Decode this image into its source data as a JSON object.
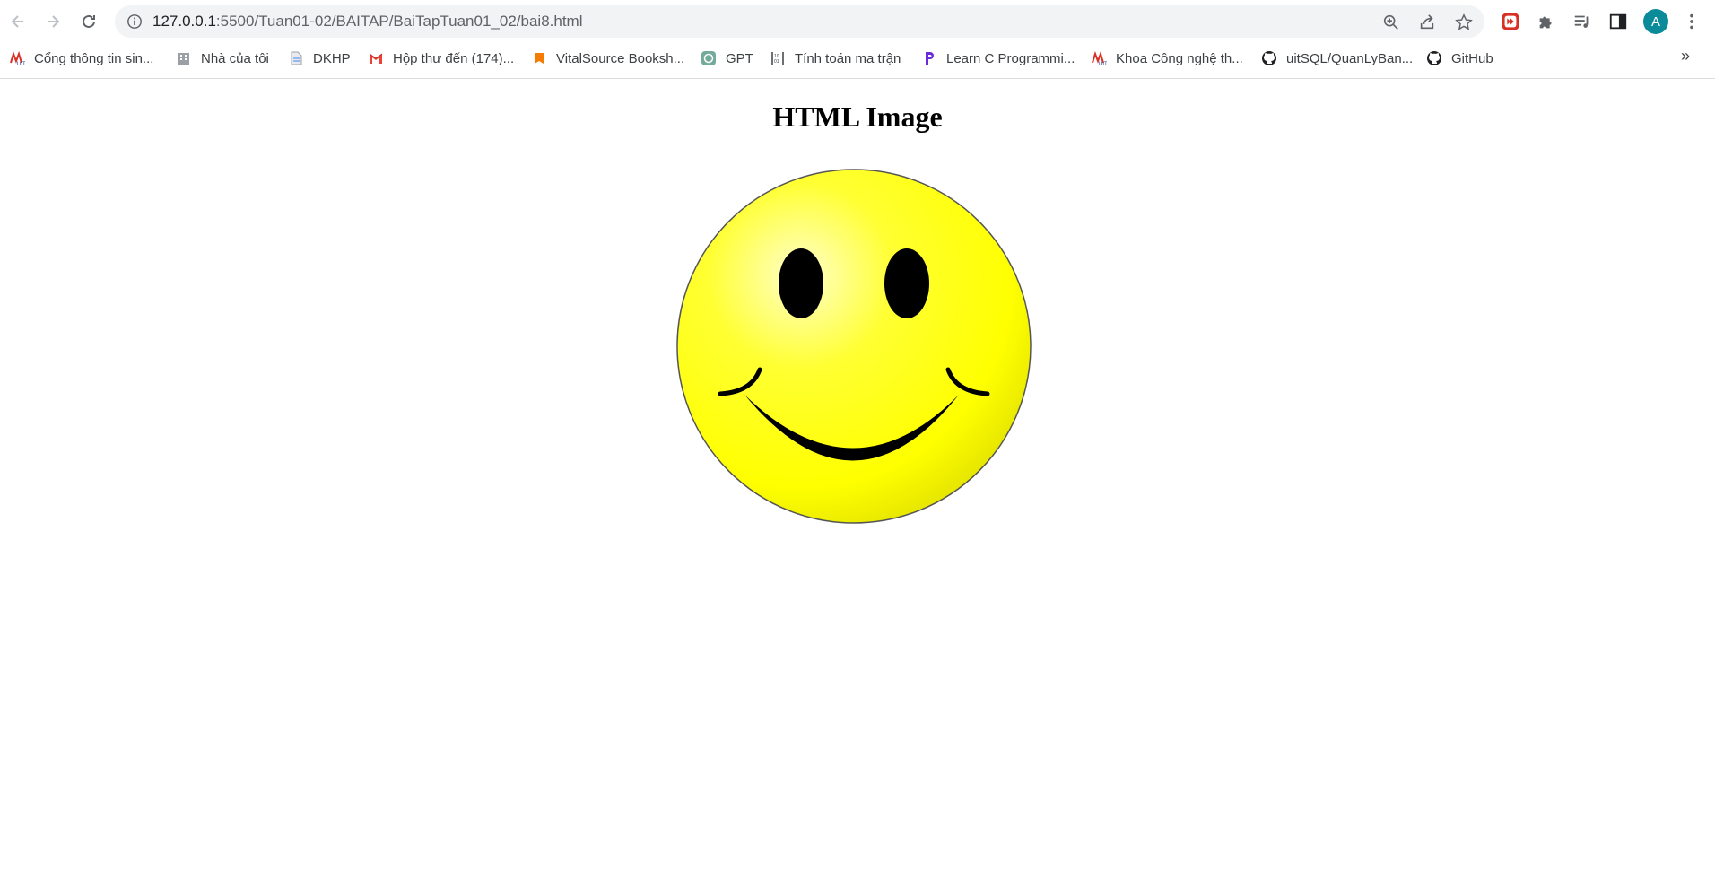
{
  "browser": {
    "url_host": "127.0.0.1",
    "url_path": ":5500/Tuan01-02/BAITAP/BaiTapTuan01_02/bai8.html",
    "profile_initial": "A",
    "bookmarks": [
      {
        "label": "Cổng thông tin sin...",
        "icon": "uit-logo-icon"
      },
      {
        "label": "Nhà của tôi",
        "icon": "building-icon"
      },
      {
        "label": "DKHP",
        "icon": "document-icon"
      },
      {
        "label": "Hộp thư đến (174)...",
        "icon": "gmail-icon"
      },
      {
        "label": "VitalSource Booksh...",
        "icon": "vitalsource-icon"
      },
      {
        "label": "GPT",
        "icon": "openai-icon"
      },
      {
        "label": "Tính toán ma trận",
        "icon": "matrix-icon"
      },
      {
        "label": "Learn C Programmi...",
        "icon": "programiz-icon"
      },
      {
        "label": "Khoa Công nghệ th...",
        "icon": "uit-logo-icon"
      },
      {
        "label": "uitSQL/QuanLyBan...",
        "icon": "github-icon"
      },
      {
        "label": "GitHub",
        "icon": "github-icon"
      }
    ]
  },
  "page": {
    "heading": "HTML Image",
    "image": "smiley-face",
    "colors": {
      "face": "#ffff00",
      "features": "#000000"
    }
  }
}
